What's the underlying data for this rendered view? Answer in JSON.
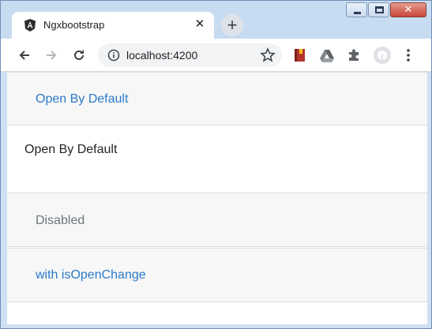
{
  "browser": {
    "tab_title": "Ngxbootstrap",
    "tab_close_glyph": "✕",
    "new_tab_glyph": "+",
    "url": "localhost:4200",
    "icons": [
      "angular-favicon-icon",
      "back-arrow-icon",
      "forward-arrow-icon",
      "reload-icon",
      "info-icon",
      "star-icon",
      "bookmark-extension-icon",
      "drive-extension-icon",
      "puzzle-extensions-icon",
      "profile-avatar-icon",
      "kebab-menu-icon"
    ]
  },
  "accordion": {
    "panels": [
      {
        "heading": "Open By Default",
        "body": "Open By Default",
        "state": "open"
      },
      {
        "heading": "Disabled",
        "state": "disabled"
      },
      {
        "heading": "with isOpenChange",
        "state": "closed"
      }
    ]
  },
  "colors": {
    "link": "#2a7ac9",
    "disabled": "#6c757d",
    "header_bg": "#f7f7f7"
  }
}
